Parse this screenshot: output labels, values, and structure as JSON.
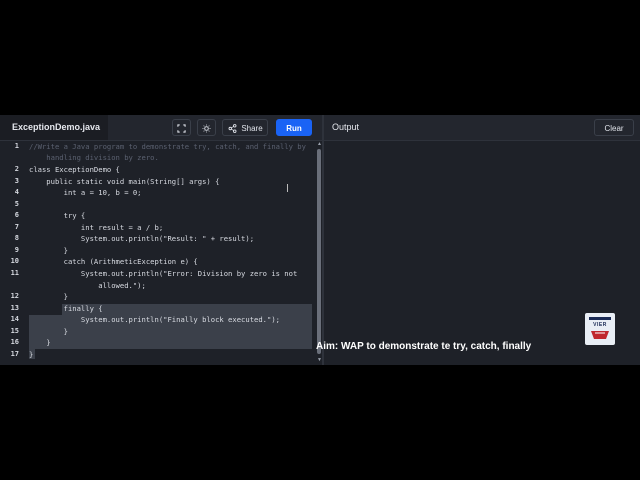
{
  "editor": {
    "file_tab": "ExceptionDemo.java",
    "share_label": "Share",
    "run_label": "Run",
    "fullscreen_icon": "fullscreen-icon",
    "theme_icon": "sun-icon",
    "share_icon": "share-icon"
  },
  "code": {
    "line_numbers": [
      "1",
      "2",
      "3",
      "4",
      "5",
      "6",
      "7",
      "8",
      "9",
      "10",
      "11",
      "12",
      "13",
      "14",
      "15",
      "16",
      "17"
    ],
    "lines": [
      "//Write a Java program to demonstrate try, catch, and finally by",
      "    handling division by zero.",
      "class ExceptionDemo {",
      "    public static void main(String[] args) {",
      "        int a = 10, b = 0;",
      "",
      "        try {",
      "            int result = a / b;",
      "            System.out.println(\"Result: \" + result);",
      "        }",
      "        catch (ArithmeticException e) {",
      "            System.out.println(\"Error: Division by zero is not",
      "                allowed.\");",
      "        }",
      "        finally {",
      "            System.out.println(\"Finally block executed.\");",
      "        }",
      "    }",
      "}"
    ]
  },
  "output": {
    "title": "Output",
    "clear_label": "Clear"
  },
  "overlay": {
    "logo_text": "VIER",
    "caption": "Aim: WAP to demonstrate te try, catch, finally"
  }
}
